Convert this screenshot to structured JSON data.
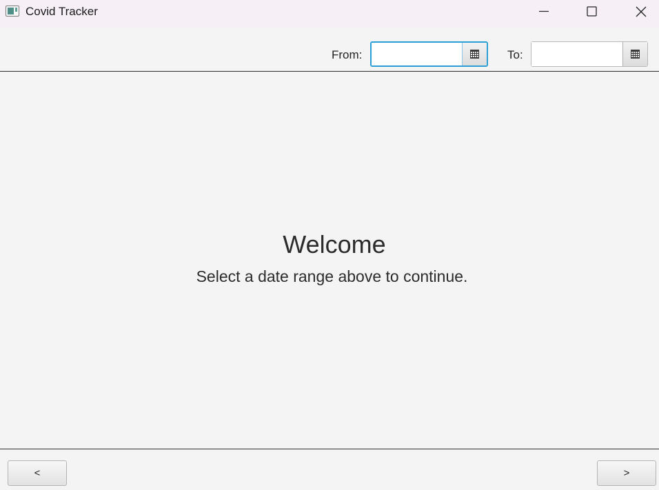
{
  "window": {
    "title": "Covid Tracker"
  },
  "toolbar": {
    "from_label": "From:",
    "from_value": "",
    "to_label": "To:",
    "to_value": ""
  },
  "content": {
    "title": "Welcome",
    "subtitle": "Select a date range above to continue."
  },
  "footer": {
    "prev_label": "<",
    "next_label": ">"
  },
  "icons": {
    "app": "app-icon",
    "minimize": "minimize-icon",
    "maximize": "maximize-icon",
    "close": "close-icon",
    "calendar": "calendar-icon"
  },
  "colors": {
    "focus_border": "#2a9fd6",
    "titlebar_bg": "#f6f0f6",
    "background": "#f4f4f4"
  }
}
